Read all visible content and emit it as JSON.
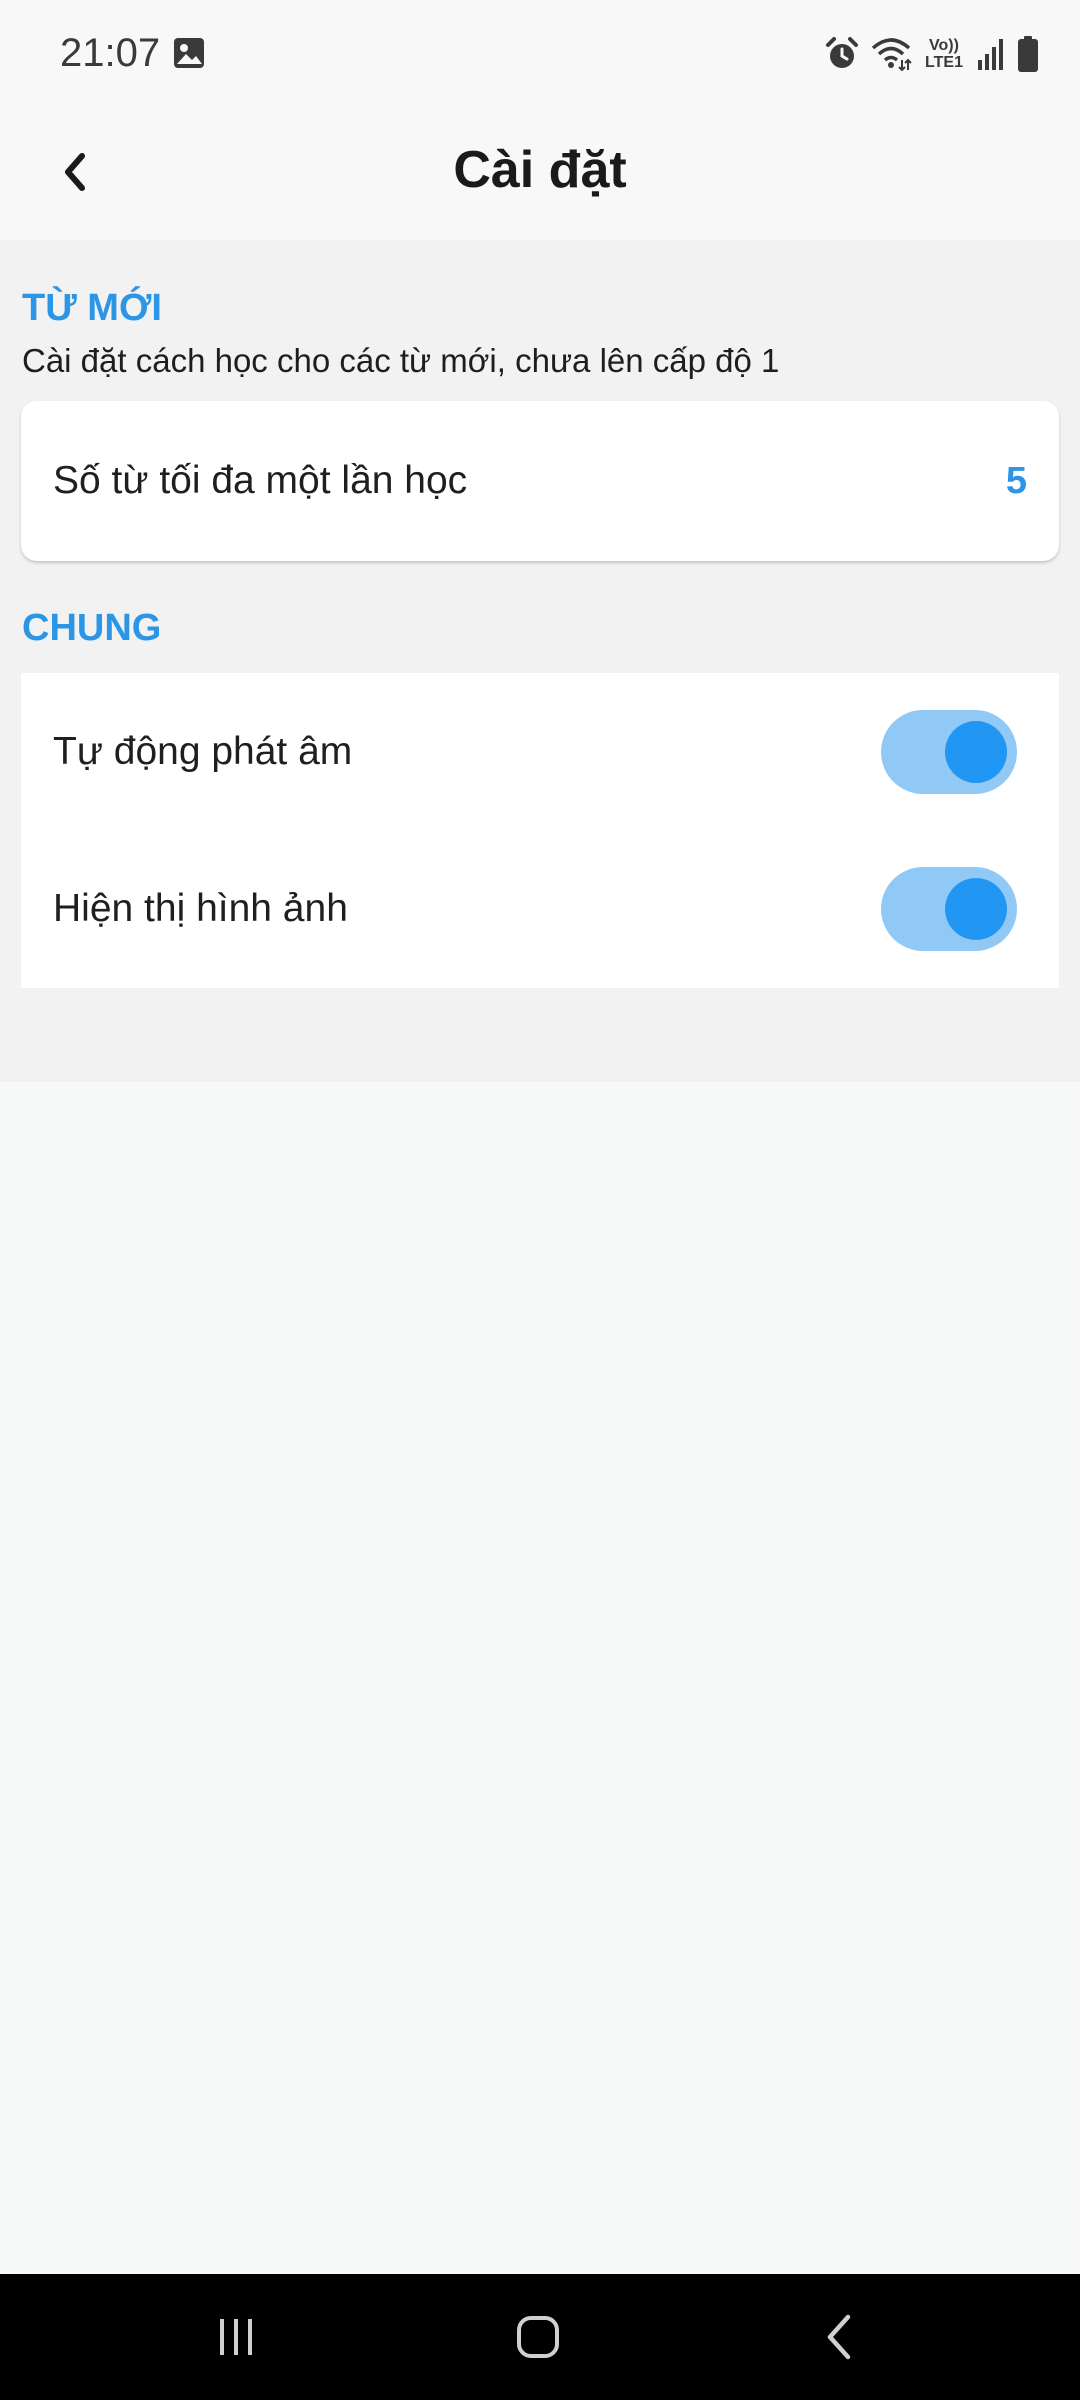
{
  "status_bar": {
    "time": "21:07",
    "volte_top": "Vo))",
    "volte_bottom": "LTE1",
    "icons": [
      "gallery-icon",
      "alarm-icon",
      "wifi-icon",
      "volte-icon",
      "signal-icon",
      "battery-icon"
    ]
  },
  "app_bar": {
    "title": "Cài đặt",
    "back_icon": "chevron-left-icon"
  },
  "sections": {
    "new_words": {
      "title": "TỪ MỚI",
      "description": "Cài đặt cách học cho các từ mới, chưa lên cấp độ 1",
      "max_words_label": "Số từ tối đa một lần học",
      "max_words_value": "5"
    },
    "general": {
      "title": "CHUNG",
      "auto_pronounce_label": "Tự động phát âm",
      "auto_pronounce_on": true,
      "show_images_label": "Hiện thị hình ảnh",
      "show_images_on": true
    }
  },
  "nav_bar": {
    "icons": [
      "recent-apps-icon",
      "home-icon",
      "back-icon"
    ]
  },
  "colors": {
    "accent": "#2b95e6",
    "toggle_thumb": "#2196f3",
    "toggle_track": "#90c9f6",
    "settings_bg": "#f2f2f2",
    "page_bg": "#f8f9f9"
  }
}
